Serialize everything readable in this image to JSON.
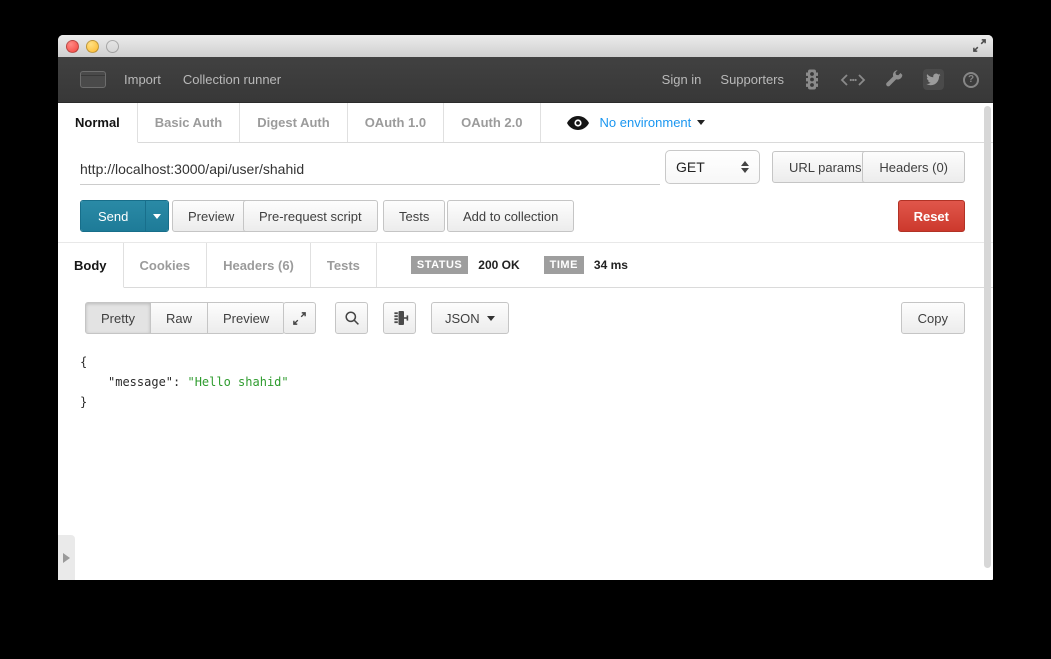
{
  "toolbar": {
    "import_label": "Import",
    "collection_runner_label": "Collection runner",
    "sign_in_label": "Sign in",
    "supporters_label": "Supporters",
    "help_glyph": "?"
  },
  "auth_tabs": {
    "tabs": [
      {
        "label": "Normal",
        "active": true
      },
      {
        "label": "Basic Auth",
        "active": false
      },
      {
        "label": "Digest Auth",
        "active": false
      },
      {
        "label": "OAuth 1.0",
        "active": false
      },
      {
        "label": "OAuth 2.0",
        "active": false
      }
    ],
    "environment_label": "No environment"
  },
  "request": {
    "url": "http://localhost:3000/api/user/shahid",
    "method": "GET",
    "url_params_label": "URL params",
    "headers_label": "Headers (0)"
  },
  "actions": {
    "send_label": "Send",
    "preview_label": "Preview",
    "prerequest_label": "Pre-request script",
    "tests_label": "Tests",
    "add_to_collection_label": "Add to collection",
    "reset_label": "Reset"
  },
  "response": {
    "tabs": [
      {
        "label": "Body",
        "active": true
      },
      {
        "label": "Cookies",
        "active": false
      },
      {
        "label": "Headers (6)",
        "active": false
      },
      {
        "label": "Tests",
        "active": false
      }
    ],
    "status_label": "STATUS",
    "status_value": "200 OK",
    "time_label": "TIME",
    "time_value": "34 ms"
  },
  "viewer": {
    "modes": [
      {
        "label": "Pretty",
        "active": true
      },
      {
        "label": "Raw",
        "active": false
      },
      {
        "label": "Preview",
        "active": false
      }
    ],
    "format_label": "JSON",
    "copy_label": "Copy"
  },
  "response_body": {
    "brace_open": "{",
    "key": "\"message\"",
    "separator": ": ",
    "value": "\"Hello shahid\"",
    "brace_close": "}"
  },
  "colors": {
    "accent_teal": "#1f7f9c",
    "danger_red": "#d9453a",
    "link_blue": "#1a96f0",
    "badge_gray": "#9e9e9e",
    "string_green": "#2f9c2f",
    "toolbar_dark": "#3c3c3c"
  }
}
